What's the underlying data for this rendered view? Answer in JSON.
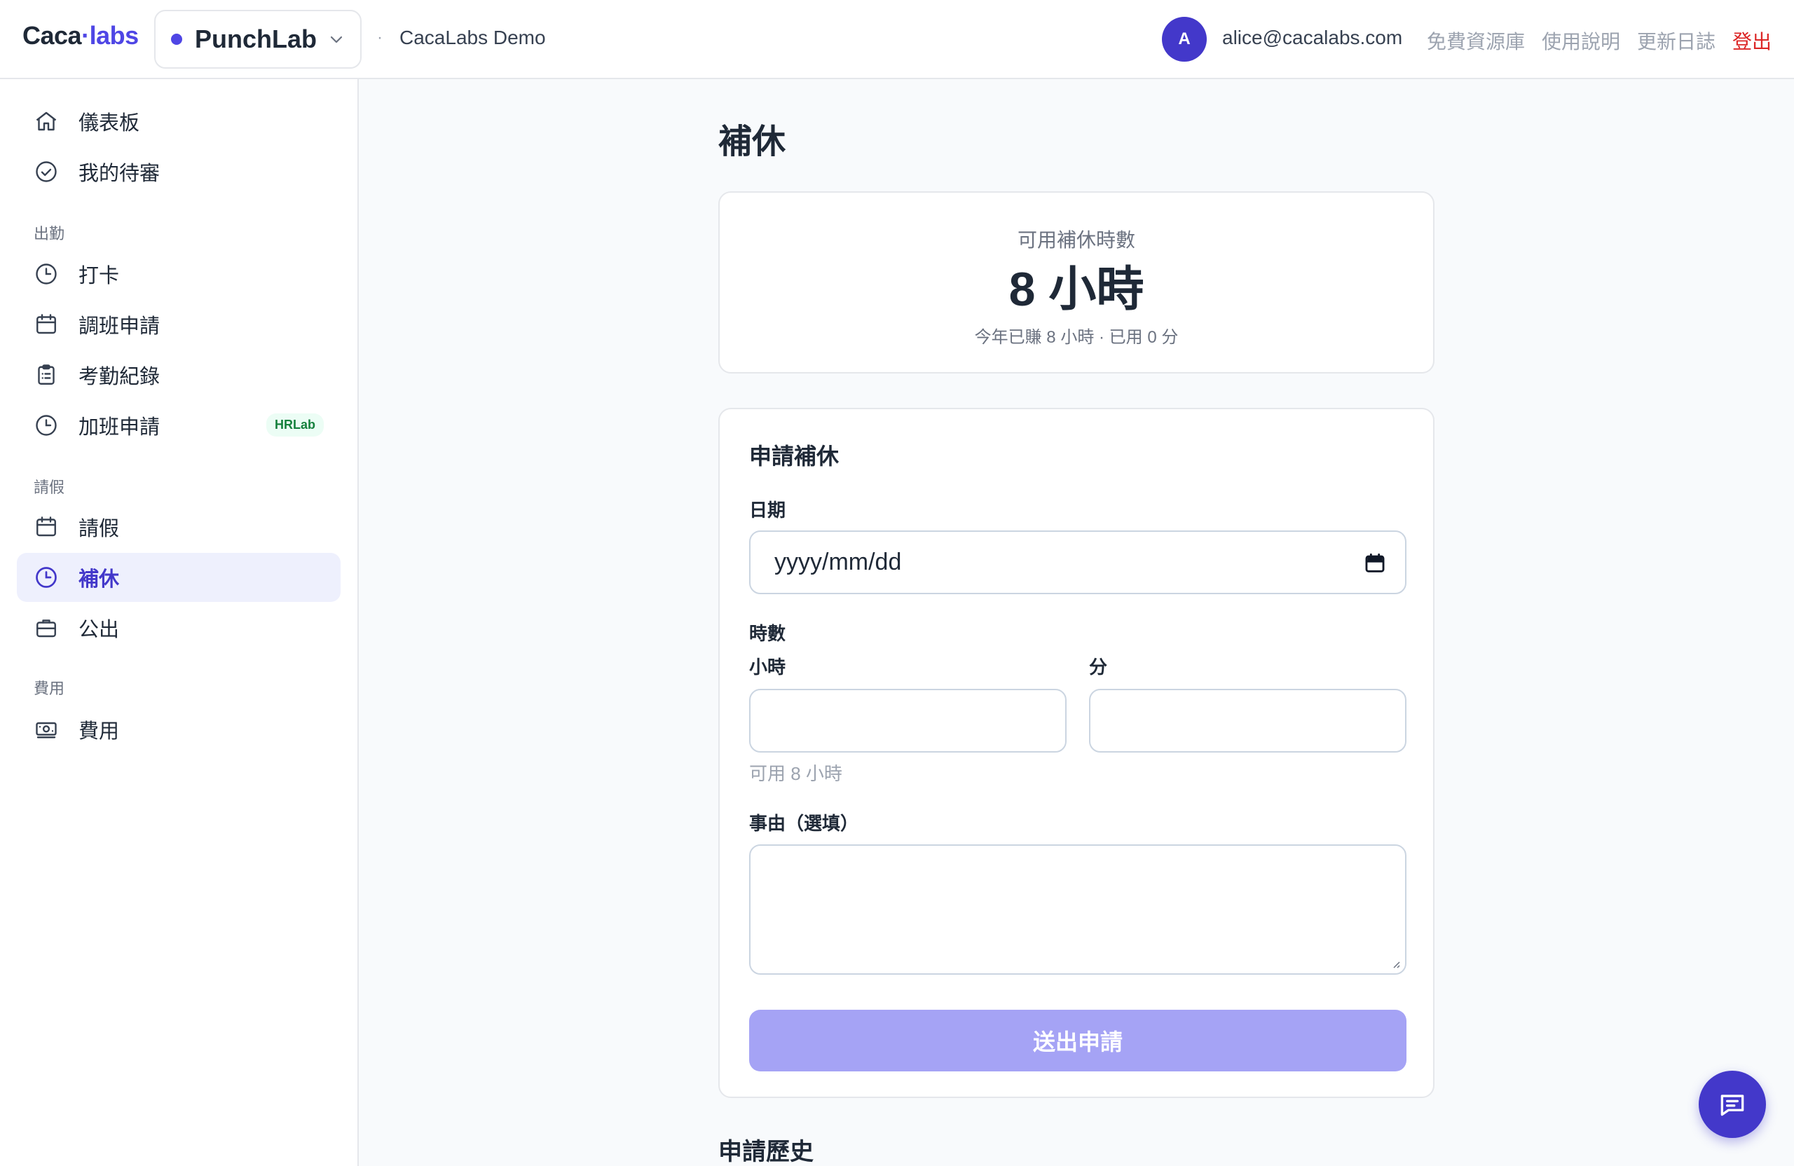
{
  "header": {
    "logo_left": "Caca",
    "logo_dot": "·",
    "logo_right": "labs",
    "app_name": "PunchLab",
    "breadcrumb_sep": "·",
    "org_name": "CacaLabs Demo",
    "avatar_letter": "A",
    "user_email": "alice@cacalabs.com",
    "links": {
      "resources": "免費資源庫",
      "help": "使用說明",
      "changelog": "更新日誌",
      "logout": "登出"
    }
  },
  "sidebar": {
    "dashboard": "儀表板",
    "my_reviews": "我的待審",
    "section_attendance": "出勤",
    "punch": "打卡",
    "shift_request": "調班申請",
    "attendance_records": "考勤紀錄",
    "overtime_request": "加班申請",
    "overtime_badge": "HRLab",
    "section_leave": "請假",
    "leave": "請假",
    "comp_leave": "補休",
    "business_trip": "公出",
    "section_expense": "費用",
    "expense": "費用"
  },
  "main": {
    "page_title": "補休",
    "balance": {
      "label": "可用補休時數",
      "value": "8 小時",
      "note": "今年已賺 8 小時 · 已用 0 分"
    },
    "form": {
      "title": "申請補休",
      "date_label": "日期",
      "date_placeholder": "yyyy/mm/dd",
      "duration_label": "時數",
      "hours_label": "小時",
      "minutes_label": "分",
      "hours_value": "",
      "minutes_value": "",
      "available_hint": "可用 8 小時",
      "reason_label": "事由（選填）",
      "reason_value": "",
      "submit_label": "送出申請"
    },
    "history_title": "申請歷史"
  },
  "colors": {
    "accent": "#4338ca",
    "accent_light": "#eef0fd",
    "submit_disabled": "#a5a3f5",
    "logout": "#dc2626",
    "badge_text": "#15803d"
  }
}
